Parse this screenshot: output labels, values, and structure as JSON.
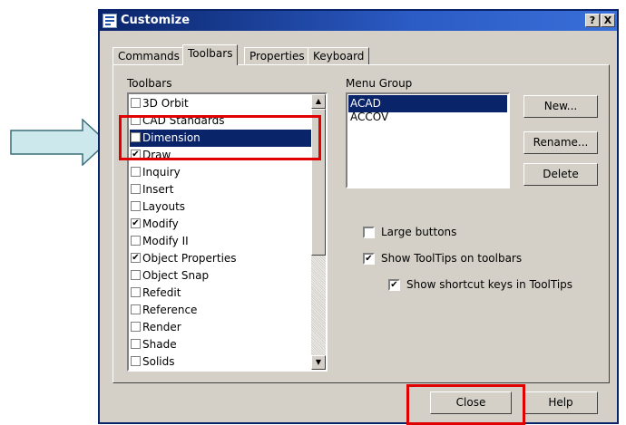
{
  "window": {
    "title": "Customize",
    "help_button": "?",
    "close_button": "X"
  },
  "tabs": [
    {
      "label": "Commands",
      "active": false
    },
    {
      "label": "Toolbars",
      "active": true
    },
    {
      "label": "Properties",
      "active": false
    },
    {
      "label": "Keyboard",
      "active": false
    }
  ],
  "toolbars_panel": {
    "label": "Toolbars",
    "items": [
      {
        "label": "3D Orbit",
        "checked": false,
        "selected": false
      },
      {
        "label": "CAD Standards",
        "checked": false,
        "selected": false
      },
      {
        "label": "Dimension",
        "checked": false,
        "selected": true
      },
      {
        "label": "Draw",
        "checked": true,
        "selected": false
      },
      {
        "label": "Inquiry",
        "checked": false,
        "selected": false
      },
      {
        "label": "Insert",
        "checked": false,
        "selected": false
      },
      {
        "label": "Layouts",
        "checked": false,
        "selected": false
      },
      {
        "label": "Modify",
        "checked": true,
        "selected": false
      },
      {
        "label": "Modify II",
        "checked": false,
        "selected": false
      },
      {
        "label": "Object Properties",
        "checked": true,
        "selected": false
      },
      {
        "label": "Object Snap",
        "checked": false,
        "selected": false
      },
      {
        "label": "Refedit",
        "checked": false,
        "selected": false
      },
      {
        "label": "Reference",
        "checked": false,
        "selected": false
      },
      {
        "label": "Render",
        "checked": false,
        "selected": false
      },
      {
        "label": "Shade",
        "checked": false,
        "selected": false
      },
      {
        "label": "Solids",
        "checked": false,
        "selected": false
      }
    ]
  },
  "menu_group": {
    "label": "Menu Group",
    "items": [
      {
        "label": "ACAD",
        "selected": true
      },
      {
        "label": "ACCOV",
        "selected": false
      }
    ]
  },
  "side_buttons": {
    "new": "New...",
    "rename": "Rename...",
    "delete": "Delete"
  },
  "options": {
    "large_buttons": {
      "label": "Large buttons",
      "checked": false
    },
    "show_tooltips": {
      "label": "Show ToolTips on toolbars",
      "checked": true
    },
    "show_shortcut_keys": {
      "label": "Show shortcut keys in ToolTips",
      "checked": true
    }
  },
  "footer": {
    "close": "Close",
    "help": "Help"
  },
  "colors": {
    "highlight": "#e00000",
    "selection": "#0a246a",
    "arrow_fill": "#cde8ec"
  },
  "icons": {
    "check": "✔",
    "scroll_up": "▲",
    "scroll_down": "▼"
  }
}
